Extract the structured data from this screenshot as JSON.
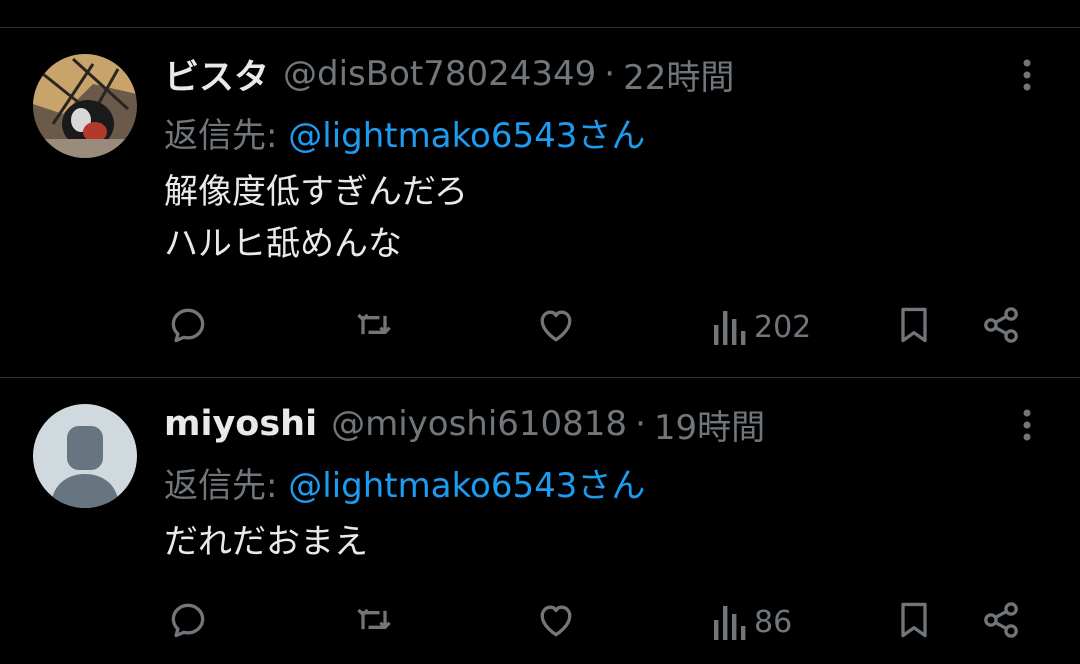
{
  "tweets": [
    {
      "name": "ビスタ",
      "handle": "@disBot78024349",
      "separator": "·",
      "time": "22時間",
      "reply_prefix": "返信先: ",
      "reply_to": "@lightmako6543さん",
      "text_lines": [
        "解像度低すぎんだろ",
        "ハルヒ舐めんな"
      ],
      "views": "202",
      "avatar_icon": "photo-avatar"
    },
    {
      "name": "miyoshi",
      "handle": "@miyoshi610818",
      "separator": "·",
      "time": "19時間",
      "reply_prefix": "返信先: ",
      "reply_to": "@lightmako6543さん",
      "text_lines": [
        "だれだおまえ"
      ],
      "views": "86",
      "avatar_icon": "default-avatar"
    }
  ],
  "icons": {
    "reply": "speech-bubble-icon",
    "retweet": "retweet-icon",
    "like": "heart-icon",
    "views": "bar-chart-icon",
    "bookmark": "bookmark-icon",
    "share": "share-icon",
    "more": "vertical-ellipsis-icon"
  },
  "colors": {
    "background": "#000000",
    "text": "#e7e9ea",
    "muted": "#71767b",
    "link": "#1d9bf0",
    "divider": "#2f3336"
  }
}
